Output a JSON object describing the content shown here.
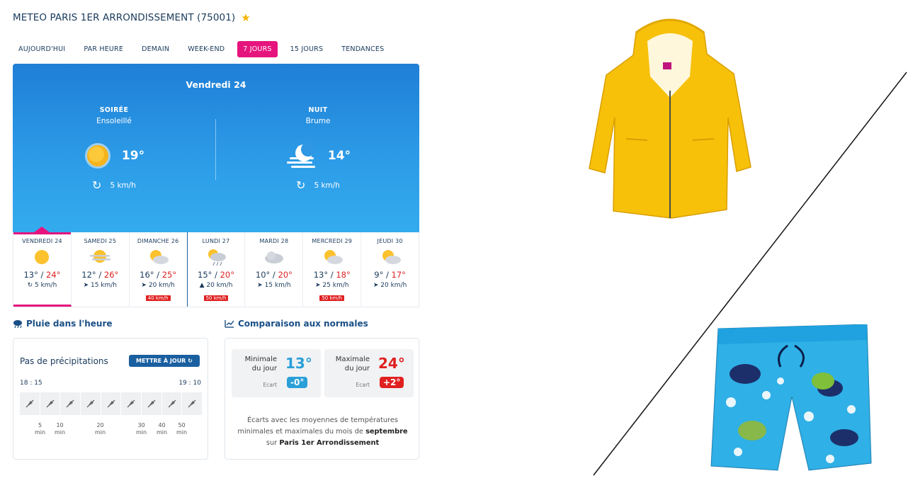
{
  "header": {
    "title": "METEO PARIS 1ER ARRONDISSEMENT (75001)",
    "favorite_icon": "star-icon"
  },
  "tabs": [
    {
      "label": "AUJOURD'HUI",
      "active": false
    },
    {
      "label": "PAR HEURE",
      "active": false
    },
    {
      "label": "DEMAIN",
      "active": false
    },
    {
      "label": "WEEK-END",
      "active": false
    },
    {
      "label": "7 JOURS",
      "active": true
    },
    {
      "label": "15 JOURS",
      "active": false
    },
    {
      "label": "TENDANCES",
      "active": false
    }
  ],
  "today": {
    "day": "Vendredi 24",
    "evening": {
      "label": "SOIRÉE",
      "desc": "Ensoleillé",
      "temp": "19°",
      "wind": "5 km/h",
      "icon": "sun-icon"
    },
    "night": {
      "label": "NUIT",
      "desc": "Brume",
      "temp": "14°",
      "wind": "5 km/h",
      "icon": "moon-fog-icon"
    }
  },
  "days": [
    {
      "name": "VENDREDI 24",
      "min": "13°",
      "max": "24°",
      "wind": "5 km/h",
      "wind_icon": "wind-variable-icon",
      "gust": "",
      "icon": "sun-icon"
    },
    {
      "name": "SAMEDI 25",
      "min": "12°",
      "max": "26°",
      "wind": "15 km/h",
      "wind_icon": "arrow-icon",
      "gust": "",
      "icon": "sun-haze-icon"
    },
    {
      "name": "DIMANCHE 26",
      "min": "16°",
      "max": "25°",
      "wind": "20 km/h",
      "wind_icon": "arrow-icon",
      "gust": "40 km/h",
      "icon": "sun-cloud-icon"
    },
    {
      "name": "LUNDI 27",
      "min": "15°",
      "max": "20°",
      "wind": "20 km/h",
      "wind_icon": "arrow-icon",
      "gust": "50 km/h",
      "icon": "sun-rain-icon"
    },
    {
      "name": "MARDI 28",
      "min": "10°",
      "max": "20°",
      "wind": "15 km/h",
      "wind_icon": "arrow-icon",
      "gust": "",
      "icon": "cloud-icon"
    },
    {
      "name": "MERCREDI 29",
      "min": "13°",
      "max": "18°",
      "wind": "25 km/h",
      "wind_icon": "arrow-icon",
      "gust": "50 km/h",
      "icon": "sun-cloud-icon"
    },
    {
      "name": "JEUDI 30",
      "min": "9°",
      "max": "17°",
      "wind": "20 km/h",
      "wind_icon": "arrow-icon",
      "gust": "",
      "icon": "sun-cloud-icon"
    }
  ],
  "rain": {
    "section_title": "Pluie dans l'heure",
    "status": "Pas de précipitations",
    "update_label": "METTRE À JOUR",
    "start_time": "18 : 15",
    "end_time": "19 : 10",
    "slots": 9,
    "min_labels": [
      {
        "n": "5",
        "u": "min"
      },
      {
        "n": "10",
        "u": "min"
      },
      {
        "n": "20",
        "u": "min"
      },
      {
        "n": "30",
        "u": "min"
      },
      {
        "n": "40",
        "u": "min"
      },
      {
        "n": "50",
        "u": "min"
      }
    ]
  },
  "comparison": {
    "section_title": "Comparaison aux normales",
    "min": {
      "label1": "Minimale",
      "label2": "du jour",
      "value": "13°",
      "ecart_label": "Ecart",
      "ecart": "-0°",
      "color": "#2a9fd8"
    },
    "max": {
      "label1": "Maximale",
      "label2": "du jour",
      "value": "24°",
      "ecart_label": "Ecart",
      "ecart": "+2°",
      "color": "#e02020"
    },
    "note_pre": "Écarts avec les moyennes de températures minimales et maximales du mois de ",
    "note_month": "septembre",
    "note_mid": " sur ",
    "note_place": "Paris 1er Arrondissement"
  },
  "colors": {
    "accent": "#e6157e",
    "primary": "#1a5fa0",
    "sky_top": "#1f7fd6",
    "sky_bottom": "#34abee",
    "max_temp": "#e02020"
  },
  "illustrations": {
    "top_right": "yellow-raincoat-image",
    "bottom_right": "floral-swim-shorts-image"
  }
}
